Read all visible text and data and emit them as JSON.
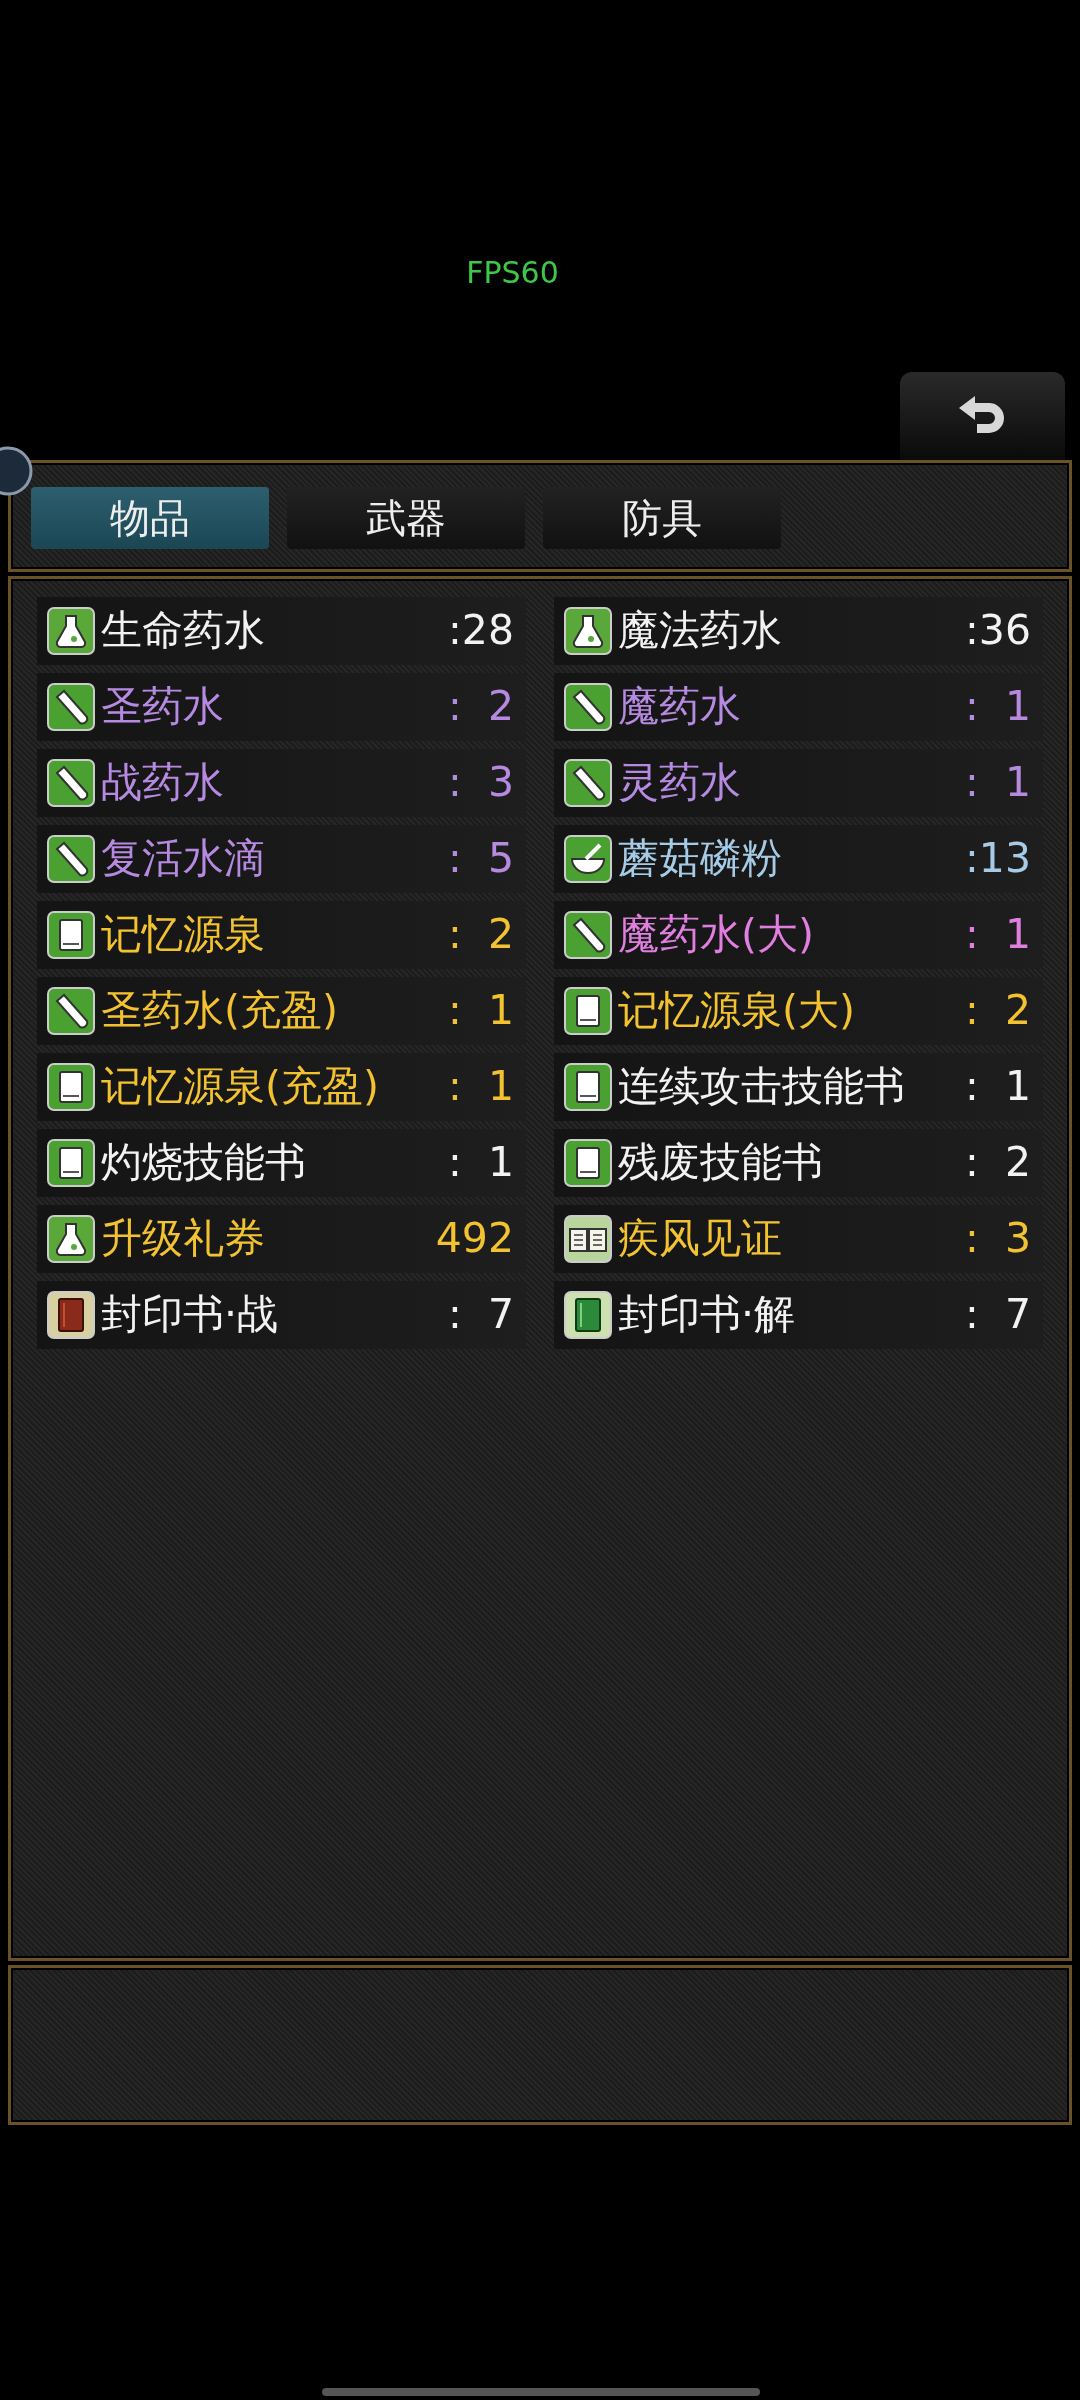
{
  "overlay": {
    "fps": "FPS60"
  },
  "tabs": [
    {
      "label": "物品",
      "selected": true
    },
    {
      "label": "武器",
      "selected": false
    },
    {
      "label": "防具",
      "selected": false
    }
  ],
  "items": [
    {
      "name": "生命药水",
      "count": ":28",
      "color": "#f2f2f2",
      "kind": "flask"
    },
    {
      "name": "魔法药水",
      "count": ":36",
      "color": "#f2f2f2",
      "kind": "flask"
    },
    {
      "name": "圣药水",
      "count": ":  2",
      "color": "#b68ae0",
      "kind": "tube"
    },
    {
      "name": "魔药水",
      "count": ":  1",
      "color": "#b68ae0",
      "kind": "tube"
    },
    {
      "name": "战药水",
      "count": ":  3",
      "color": "#b68ae0",
      "kind": "tube"
    },
    {
      "name": "灵药水",
      "count": ":  1",
      "color": "#b68ae0",
      "kind": "tube"
    },
    {
      "name": "复活水滴",
      "count": ":  5",
      "color": "#b68ae0",
      "kind": "tube"
    },
    {
      "name": "蘑菇磷粉",
      "count": ":13",
      "color": "#a6cbe6",
      "kind": "bowl"
    },
    {
      "name": "记忆源泉",
      "count": ":  2",
      "color": "#f2c230",
      "kind": "book"
    },
    {
      "name": "魔药水(大)",
      "count": ":  1",
      "color": "#e07fe0",
      "kind": "tube"
    },
    {
      "name": "圣药水(充盈)",
      "count": ":  1",
      "color": "#f2c230",
      "kind": "tube"
    },
    {
      "name": "记忆源泉(大)",
      "count": ":  2",
      "color": "#f2c230",
      "kind": "book"
    },
    {
      "name": "记忆源泉(充盈)",
      "count": ":  1",
      "color": "#f2c230",
      "kind": "book"
    },
    {
      "name": "连续攻击技能书",
      "count": ":  1",
      "color": "#f2f2f2",
      "kind": "book"
    },
    {
      "name": "灼烧技能书",
      "count": ":  1",
      "color": "#f2f2f2",
      "kind": "book"
    },
    {
      "name": "残废技能书",
      "count": ":  2",
      "color": "#f2f2f2",
      "kind": "book"
    },
    {
      "name": "升级礼券",
      "count": "492",
      "color": "#f2c230",
      "kind": "flask"
    },
    {
      "name": "疾风见证",
      "count": ":  3",
      "color": "#f2c230",
      "kind": "openbook"
    },
    {
      "name": "封印书·战",
      "count": ":  7",
      "color": "#f2f2f2",
      "kind": "redbook"
    },
    {
      "name": "封印书·解",
      "count": ":  7",
      "color": "#f2f2f2",
      "kind": "greenbook"
    }
  ]
}
